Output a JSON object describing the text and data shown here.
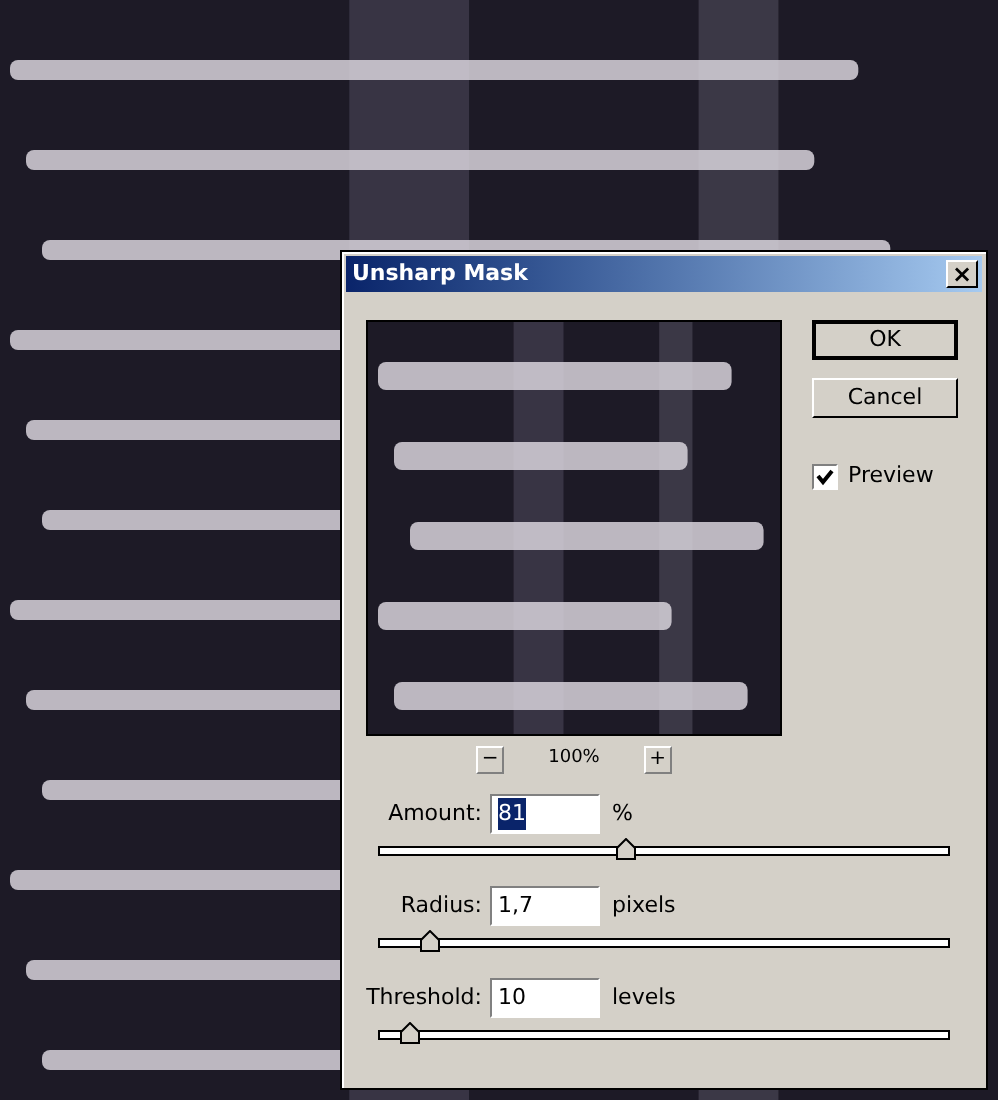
{
  "dialog": {
    "title": "Unsharp Mask",
    "close": "×",
    "zoom_out": "−",
    "zoom_level": "100%",
    "zoom_in": "+",
    "buttons": [
      {
        "label": "OK",
        "default": true
      },
      {
        "label": "Cancel",
        "default": false
      }
    ],
    "preview": {
      "label": "Preview",
      "checked": true
    },
    "params": [
      {
        "label": "Amount:",
        "value": "81",
        "value_selected": true,
        "unit": "%",
        "level": 0.435
      },
      {
        "label": "Radius:",
        "value": "1,7",
        "value_selected": false,
        "unit": "pixels",
        "level": 0.09
      },
      {
        "label": "Threshold:",
        "value": "10",
        "value_selected": false,
        "unit": "levels",
        "level": 0.056
      }
    ]
  }
}
